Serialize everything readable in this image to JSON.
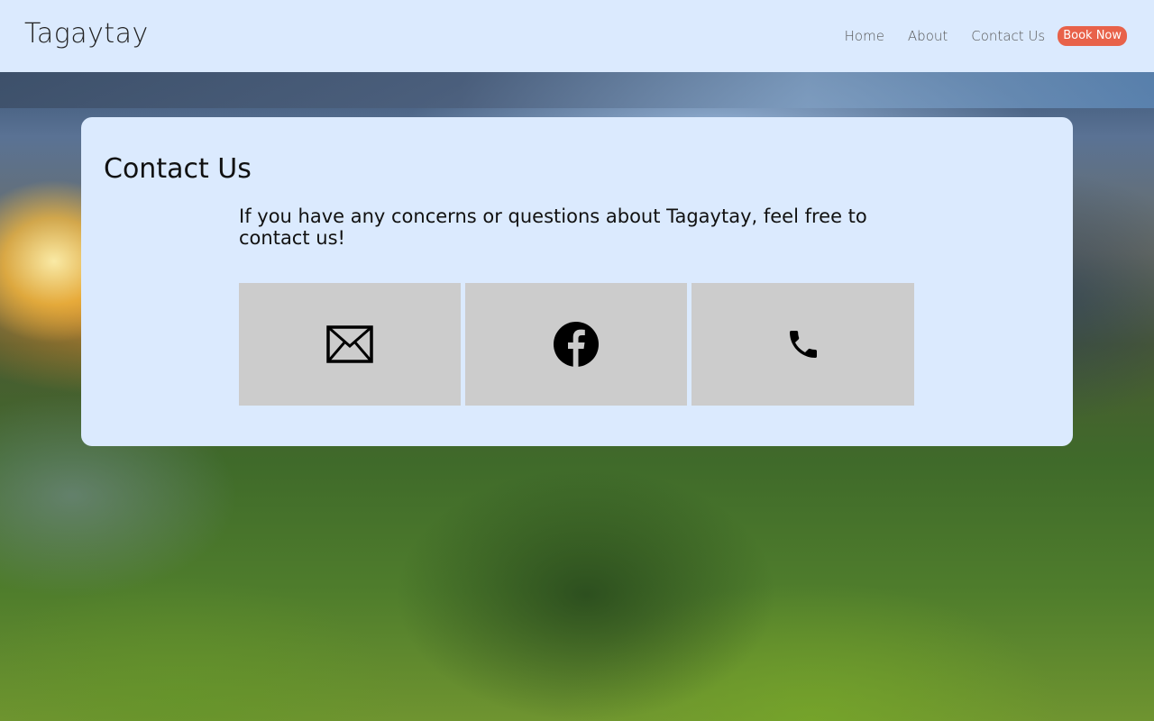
{
  "header": {
    "logo": "Tagaytay",
    "nav": {
      "home": "Home",
      "about": "About",
      "contact": "Contact Us",
      "book": "Book Now"
    },
    "colors": {
      "header_bg": "#dbeafe",
      "book_button_bg": "#e8624a"
    }
  },
  "contact_card": {
    "title": "Contact Us",
    "message": "If you have any concerns or questions about Tagaytay, feel free to contact us!",
    "tiles": [
      {
        "icon": "envelope-icon"
      },
      {
        "icon": "facebook-icon"
      },
      {
        "icon": "phone-icon"
      }
    ],
    "colors": {
      "card_bg": "#dbeafe",
      "tile_bg": "#cccccc"
    }
  }
}
